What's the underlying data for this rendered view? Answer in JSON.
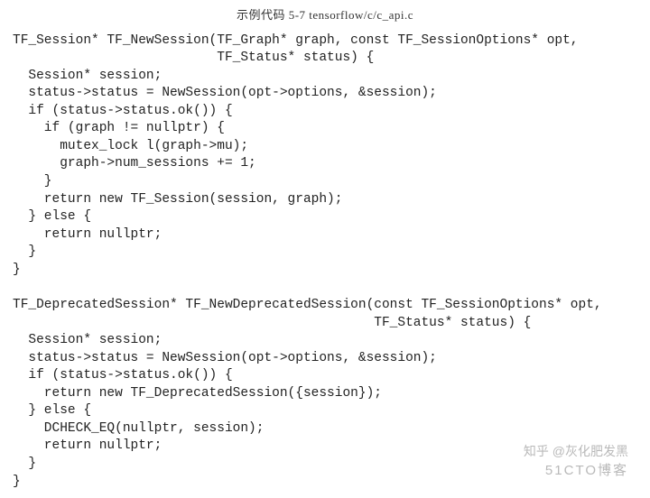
{
  "title": "示例代码 5-7  tensorflow/c/c_api.c",
  "code": "TF_Session* TF_NewSession(TF_Graph* graph, const TF_SessionOptions* opt,\n                          TF_Status* status) {\n  Session* session;\n  status->status = NewSession(opt->options, &session);\n  if (status->status.ok()) {\n    if (graph != nullptr) {\n      mutex_lock l(graph->mu);\n      graph->num_sessions += 1;\n    }\n    return new TF_Session(session, graph);\n  } else {\n    return nullptr;\n  }\n}\n\nTF_DeprecatedSession* TF_NewDeprecatedSession(const TF_SessionOptions* opt,\n                                              TF_Status* status) {\n  Session* session;\n  status->status = NewSession(opt->options, &session);\n  if (status->status.ok()) {\n    return new TF_DeprecatedSession({session});\n  } else {\n    DCHECK_EQ(nullptr, session);\n    return nullptr;\n  }\n}",
  "watermark_zhihu": "知乎 @灰化肥发黑",
  "watermark_site": "51CTO博客"
}
